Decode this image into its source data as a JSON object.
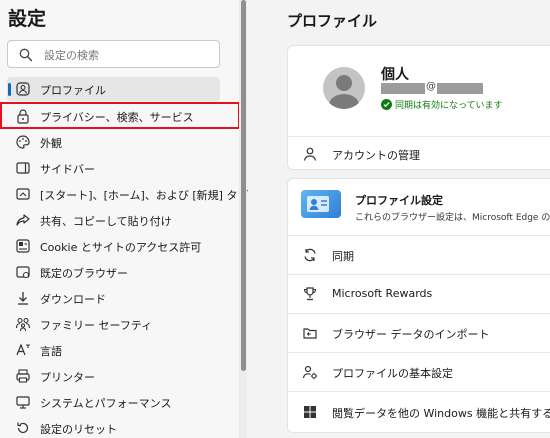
{
  "sidebar": {
    "title": "設定",
    "search_placeholder": "設定の検索",
    "items": [
      {
        "label": "プロファイル",
        "icon": "profile-icon"
      },
      {
        "label": "プライバシー、検索、サービス",
        "icon": "lock-icon"
      },
      {
        "label": "外観",
        "icon": "appearance-icon"
      },
      {
        "label": "サイドバー",
        "icon": "sidebar-icon"
      },
      {
        "label": "[スタート]、[ホーム]、および [新規] タブ",
        "icon": "home-icon"
      },
      {
        "label": "共有、コピーして貼り付け",
        "icon": "share-icon"
      },
      {
        "label": "Cookie とサイトのアクセス許可",
        "icon": "cookie-icon"
      },
      {
        "label": "既定のブラウザー",
        "icon": "browser-icon"
      },
      {
        "label": "ダウンロード",
        "icon": "download-icon"
      },
      {
        "label": "ファミリー セーフティ",
        "icon": "family-icon"
      },
      {
        "label": "言語",
        "icon": "language-icon"
      },
      {
        "label": "プリンター",
        "icon": "printer-icon"
      },
      {
        "label": "システムとパフォーマンス",
        "icon": "system-icon"
      },
      {
        "label": "設定のリセット",
        "icon": "reset-icon"
      }
    ]
  },
  "main": {
    "title": "プロファイル",
    "profile": {
      "name": "個人",
      "at": "@",
      "sync_status": "同期は有効になっています",
      "manage_account": "アカウントの管理"
    },
    "settings_card": {
      "title": "プロファイル設定",
      "description": "これらのブラウザー設定は、Microsoft Edge のプロフ",
      "rows": [
        {
          "label": "同期",
          "icon": "sync-icon"
        },
        {
          "label": "Microsoft Rewards",
          "icon": "rewards-icon"
        },
        {
          "label": "ブラウザー データのインポート",
          "icon": "import-icon"
        },
        {
          "label": "プロファイルの基本設定",
          "icon": "profile-preferences-icon"
        },
        {
          "label": "閲覧データを他の Windows 機能と共有する",
          "icon": "windows-icon"
        }
      ]
    }
  },
  "colors": {
    "accent": "#0f6cbd",
    "highlight": "#e3131b",
    "sync_green": "#107c10"
  }
}
